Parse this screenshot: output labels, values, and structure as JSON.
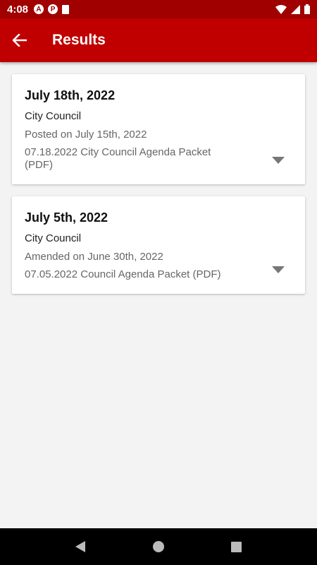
{
  "status_bar": {
    "time": "4:08",
    "icons_left": [
      "app-icon-a",
      "app-icon-p",
      "sd-card-icon"
    ],
    "icons_right": [
      "wifi-icon",
      "signal-icon",
      "battery-icon"
    ],
    "app_badge_a": "A",
    "app_badge_p": "P"
  },
  "app_bar": {
    "title": "Results",
    "back_icon": "arrow-back-icon",
    "color": "#c00000"
  },
  "results": [
    {
      "date": "July 18th, 2022",
      "body": "City Council",
      "posted": "Posted on July 15th, 2022",
      "link": "07.18.2022 City Council Agenda Packet (PDF)"
    },
    {
      "date": "July 5th, 2022",
      "body": "City Council",
      "posted": "Amended on June 30th, 2022",
      "link": "07.05.2022 Council Agenda Packet (PDF)"
    }
  ],
  "nav_bar": {
    "items": [
      "back-triangle-icon",
      "home-circle-icon",
      "recents-square-icon"
    ]
  }
}
